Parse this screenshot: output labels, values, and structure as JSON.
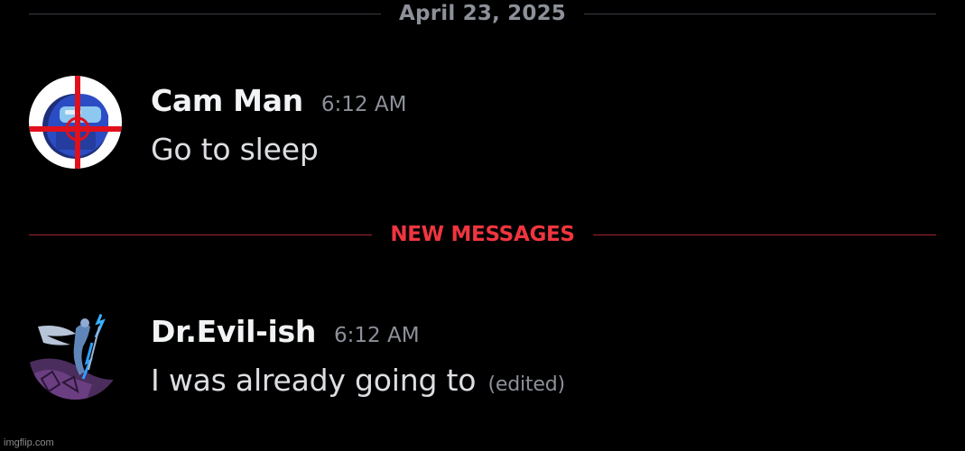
{
  "date_divider": {
    "label": "April 23, 2025"
  },
  "new_divider": {
    "label": "NEW MESSAGES"
  },
  "messages": [
    {
      "username": "Cam Man",
      "timestamp": "6:12 AM",
      "text": "Go to sleep",
      "edited": ""
    },
    {
      "username": "Dr.Evil-ish",
      "timestamp": "6:12 AM",
      "text": "I was already going to",
      "edited": "(edited)"
    }
  ],
  "watermark": "imgflip.com",
  "colors": {
    "background": "#000000",
    "new_messages_accent": "#f0353f",
    "username": "#f2f3f5",
    "muted": "#8d9099"
  }
}
